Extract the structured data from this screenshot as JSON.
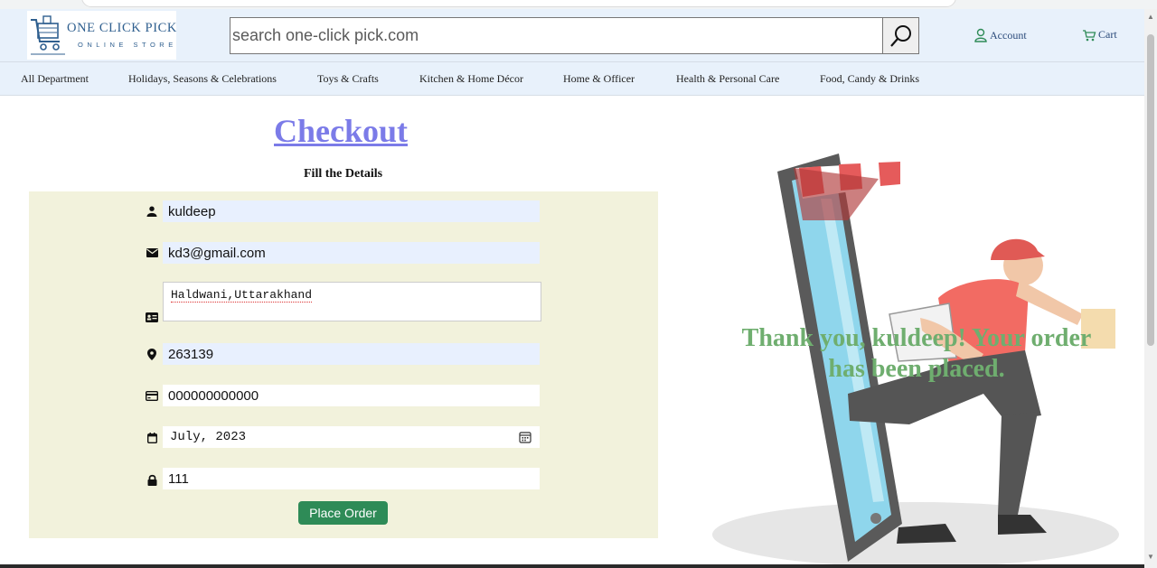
{
  "header": {
    "logo_title": "ONE CLICK PICK",
    "logo_subtitle": "ONLINE STORE",
    "search_placeholder": "search one-click pick.com",
    "account_label": "Account",
    "cart_label": "Cart"
  },
  "nav": {
    "items": [
      "All Department",
      "Holidays, Seasons & Celebrations",
      "Toys & Crafts",
      "Kitchen & Home Décor",
      "Home & Officer",
      "Health & Personal Care",
      "Food, Candy & Drinks"
    ]
  },
  "checkout": {
    "title": "Checkout",
    "subtitle": "Fill the Details",
    "name_value": "kuldeep",
    "email_value": "kd3@gmail.com",
    "address_value": "Haldwani,Uttarakhand",
    "pincode_value": "263139",
    "card_value": "000000000000",
    "expiry_value": "July, 2023",
    "cvv_value": "111",
    "submit_label": "Place Order"
  },
  "confirmation": {
    "message": "Thank you, kuldeep! Your order has been placed."
  },
  "colors": {
    "header_bg": "#e8f1fb",
    "title_color": "#7b7be8",
    "panel_bg": "#f2f2dc",
    "button_bg": "#2e8b57",
    "message_color": "#6fae6f"
  }
}
